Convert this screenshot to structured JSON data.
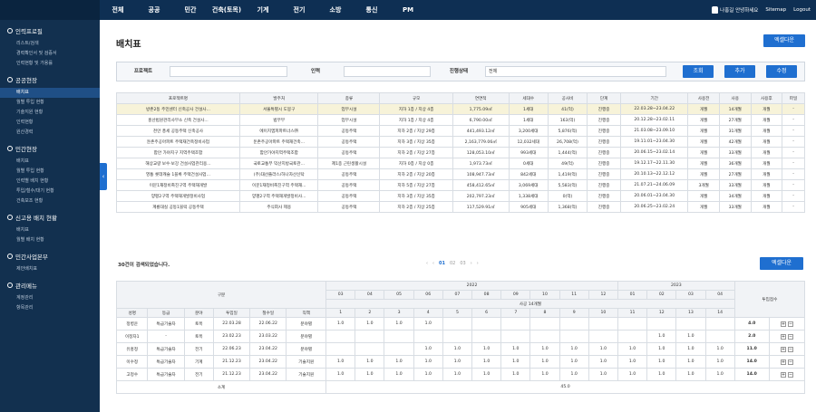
{
  "nav": [
    "전체",
    "공공",
    "민간",
    "건축(토목)",
    "기계",
    "전기",
    "소방",
    "통신",
    "PM"
  ],
  "user": {
    "greeting": "나홍길 안녕하세요",
    "sitemap": "Sitemap",
    "logout": "Logout"
  },
  "sidebar": [
    {
      "title": "인력프로필",
      "items": [
        "리스트/검색",
        "경력확인서 및 검증서",
        "인력현황 및 가용률"
      ]
    },
    {
      "title": "공공현장",
      "items": [
        "배치표",
        "월별 투입 현황",
        "기술지원 현황",
        "인력현황",
        "원산경력"
      ]
    },
    {
      "title": "민간현장",
      "items": [
        "배치표",
        "월별 투입 현황",
        "인력별 배치 현황",
        "투입/철수/대기 현황",
        "건축보조 현황"
      ]
    },
    {
      "title": "신고용 배치 현황",
      "items": [
        "배치표",
        "월별 배치 현황"
      ]
    },
    {
      "title": "민간사업본부",
      "items": [
        "제안배치표"
      ]
    },
    {
      "title": "관리메뉴",
      "items": [
        "계정관리",
        "항목관리"
      ]
    }
  ],
  "page": {
    "title": "배치표",
    "excel": "엑셀다운",
    "search_btn": "조회",
    "add_btn": "추가",
    "edit_btn": "수정",
    "count": "30건이 검색되었습니다.",
    "excel2": "엑셀다운"
  },
  "filter": {
    "project_label": "프로젝트",
    "person_label": "인력",
    "status_label": "진행상태",
    "status_value": "전체"
  },
  "pager": [
    "‹",
    "‹",
    "01",
    "02",
    "03",
    "›",
    "›"
  ],
  "t1": {
    "headers": [
      "프로젝트명",
      "발주처",
      "종류",
      "규모",
      "연면적",
      "세대수",
      "공사비",
      "단계",
      "기간",
      "사용전",
      "사용",
      "사용후",
      "파일"
    ],
    "rows": [
      [
        "방촌2동 주민센터 신축공사 건설사...",
        "서울특별시 도봉구",
        "업무시설",
        "지하 1층 / 지상 4층",
        "1,775.09㎡",
        "1세대",
        "41(억)",
        "진행중",
        "22.03.28~23.04.22",
        "개월",
        "14개월",
        "개월",
        "-"
      ],
      [
        "홍산법원관리사무소 신축 건설사...",
        "법무부",
        "업무시설",
        "지하 1층 / 지상 4층",
        "6,790.00㎡",
        "1세대",
        "163(억)",
        "진행중",
        "20.12.28~23.02.11",
        "개월",
        "27개월",
        "개월",
        "-"
      ],
      [
        "천안 풍세 공동주택 신축공사",
        "에이치엠피파트너스㈜",
        "공동주택",
        "지하 2층 / 지상 29층",
        "441,493.12㎡",
        "3,200세대",
        "5,876(억)",
        "진행중",
        "21.03.08~23.09.10",
        "개월",
        "31개월",
        "개월",
        "-"
      ],
      [
        "둔촌주공아파트 주택재건축정비사업",
        "둔촌주공아파트 주택재건축...",
        "공동주택",
        "지하 3층 / 지상 35층",
        "2,163,779.06㎡",
        "12,032세대",
        "26,708(억)",
        "진행중",
        "19.11.01~23.04.30",
        "개월",
        "42개월",
        "개월",
        "-"
      ],
      [
        "합안 가야지구 지역주택조합",
        "함안가야지역주택조합",
        "공동주택",
        "지하 2층 / 지상 27층",
        "128,053.10㎡",
        "993세대",
        "1,444(억)",
        "진행중",
        "20.06.15~23.02.14",
        "개월",
        "33개월",
        "개월",
        "-"
      ],
      [
        "해상교량 보수·보강 건설사업관리용...",
        "국토교통부 익산지방국토관...",
        "제1종 근린생활시설",
        "지하 0층 / 지상 0층",
        "1,973.73㎡",
        "0세대",
        "49(억)",
        "진행중",
        "19.12.17~22.11.30",
        "개월",
        "36개월",
        "개월",
        "-"
      ],
      [
        "영통 롯데캐슬 1블록 주택건설사업...",
        "(주)대산플라스/하나자산신탁",
        "공동주택",
        "지하 2층 / 지상 20층",
        "108,947.73㎡",
        "842세대",
        "1,419(억)",
        "진행중",
        "20.10.13~22.12.12",
        "개월",
        "27개월",
        "개월",
        "-"
      ],
      [
        "이문1재정비촉진구역 주택재개발",
        "이문1재정비촉진구역 주택재...",
        "공동주택",
        "지하 5층 / 지상 27층",
        "458,412.65㎡",
        "3,069세대",
        "5,583(억)",
        "진행중",
        "21.07.21~24.06.09",
        "3개월",
        "33개월",
        "개월",
        "-"
      ],
      [
        "양평2구역 주택재개발정비사업",
        "양평2구역 주택재개발정비사...",
        "공동주택",
        "지하 3층 / 지상 35층",
        "202,797.23㎡",
        "1,338세대",
        "0(억)",
        "진행중",
        "20.06.01~23.04.30",
        "개월",
        "34개월",
        "개월",
        "-"
      ],
      [
        "계룡대실 공동1블럭 공동주택",
        "주식회사 제용",
        "공동주택",
        "지하 2층 / 지상 25층",
        "117,529.91㎡",
        "905세대",
        "1,368(억)",
        "진행중",
        "20.06.25~23.02.24",
        "개월",
        "33개월",
        "개월",
        "-"
      ]
    ]
  },
  "t2": {
    "gubun": "구분",
    "y2022": "2022",
    "y2023": "2023",
    "total_label": "투입점수",
    "months": [
      "03",
      "04",
      "05",
      "06",
      "07",
      "08",
      "09",
      "10",
      "11",
      "12",
      "01",
      "02",
      "03",
      "04"
    ],
    "period": "사공 14개월",
    "seq": [
      "1",
      "2",
      "3",
      "4",
      "5",
      "6",
      "7",
      "8",
      "9",
      "10",
      "11",
      "12",
      "13",
      "14"
    ],
    "cols": [
      "성명",
      "등급",
      "분야",
      "투입일",
      "철수일",
      "직책"
    ],
    "rows": [
      {
        "name": "정병운",
        "grade": "특급기술자",
        "field": "토목",
        "in": "22.03.28",
        "out": "22.06.22",
        "role": "분야별",
        "vals": [
          "1.0",
          "1.0",
          "1.0",
          "1.0",
          "",
          "",
          "",
          "",
          "",
          "",
          "",
          "",
          "",
          ""
        ],
        "total": "4.0"
      },
      {
        "name": "이정자1",
        "grade": "-",
        "field": "토목",
        "in": "23.02.23",
        "out": "23.03.22",
        "role": "분야별",
        "vals": [
          "",
          "",
          "",
          "",
          "",
          "",
          "",
          "",
          "",
          "",
          "",
          "1.0",
          "1.0",
          ""
        ],
        "total": "2.0"
      },
      {
        "name": "유홍정",
        "grade": "특급기술자",
        "field": "전기",
        "in": "22.06.23",
        "out": "23.04.22",
        "role": "분야별",
        "vals": [
          "",
          "",
          "",
          "1.0",
          "1.0",
          "1.0",
          "1.0",
          "1.0",
          "1.0",
          "1.0",
          "1.0",
          "1.0",
          "1.0",
          "1.0"
        ],
        "total": "11.0"
      },
      {
        "name": "이수정",
        "grade": "특급기술자",
        "field": "기계",
        "in": "21.12.23",
        "out": "23.04.22",
        "role": "기술지원",
        "vals": [
          "1.0",
          "1.0",
          "1.0",
          "1.0",
          "1.0",
          "1.0",
          "1.0",
          "1.0",
          "1.0",
          "1.0",
          "1.0",
          "1.0",
          "1.0",
          "1.0"
        ],
        "total": "14.0"
      },
      {
        "name": "고정수",
        "grade": "특급기술자",
        "field": "전기",
        "in": "21.12.23",
        "out": "23.04.22",
        "role": "기술지원",
        "vals": [
          "1.0",
          "1.0",
          "1.0",
          "1.0",
          "1.0",
          "1.0",
          "1.0",
          "1.0",
          "1.0",
          "1.0",
          "1.0",
          "1.0",
          "1.0",
          "1.0"
        ],
        "total": "14.0"
      }
    ],
    "subtotal_label": "소계",
    "subtotal": "45.0"
  }
}
